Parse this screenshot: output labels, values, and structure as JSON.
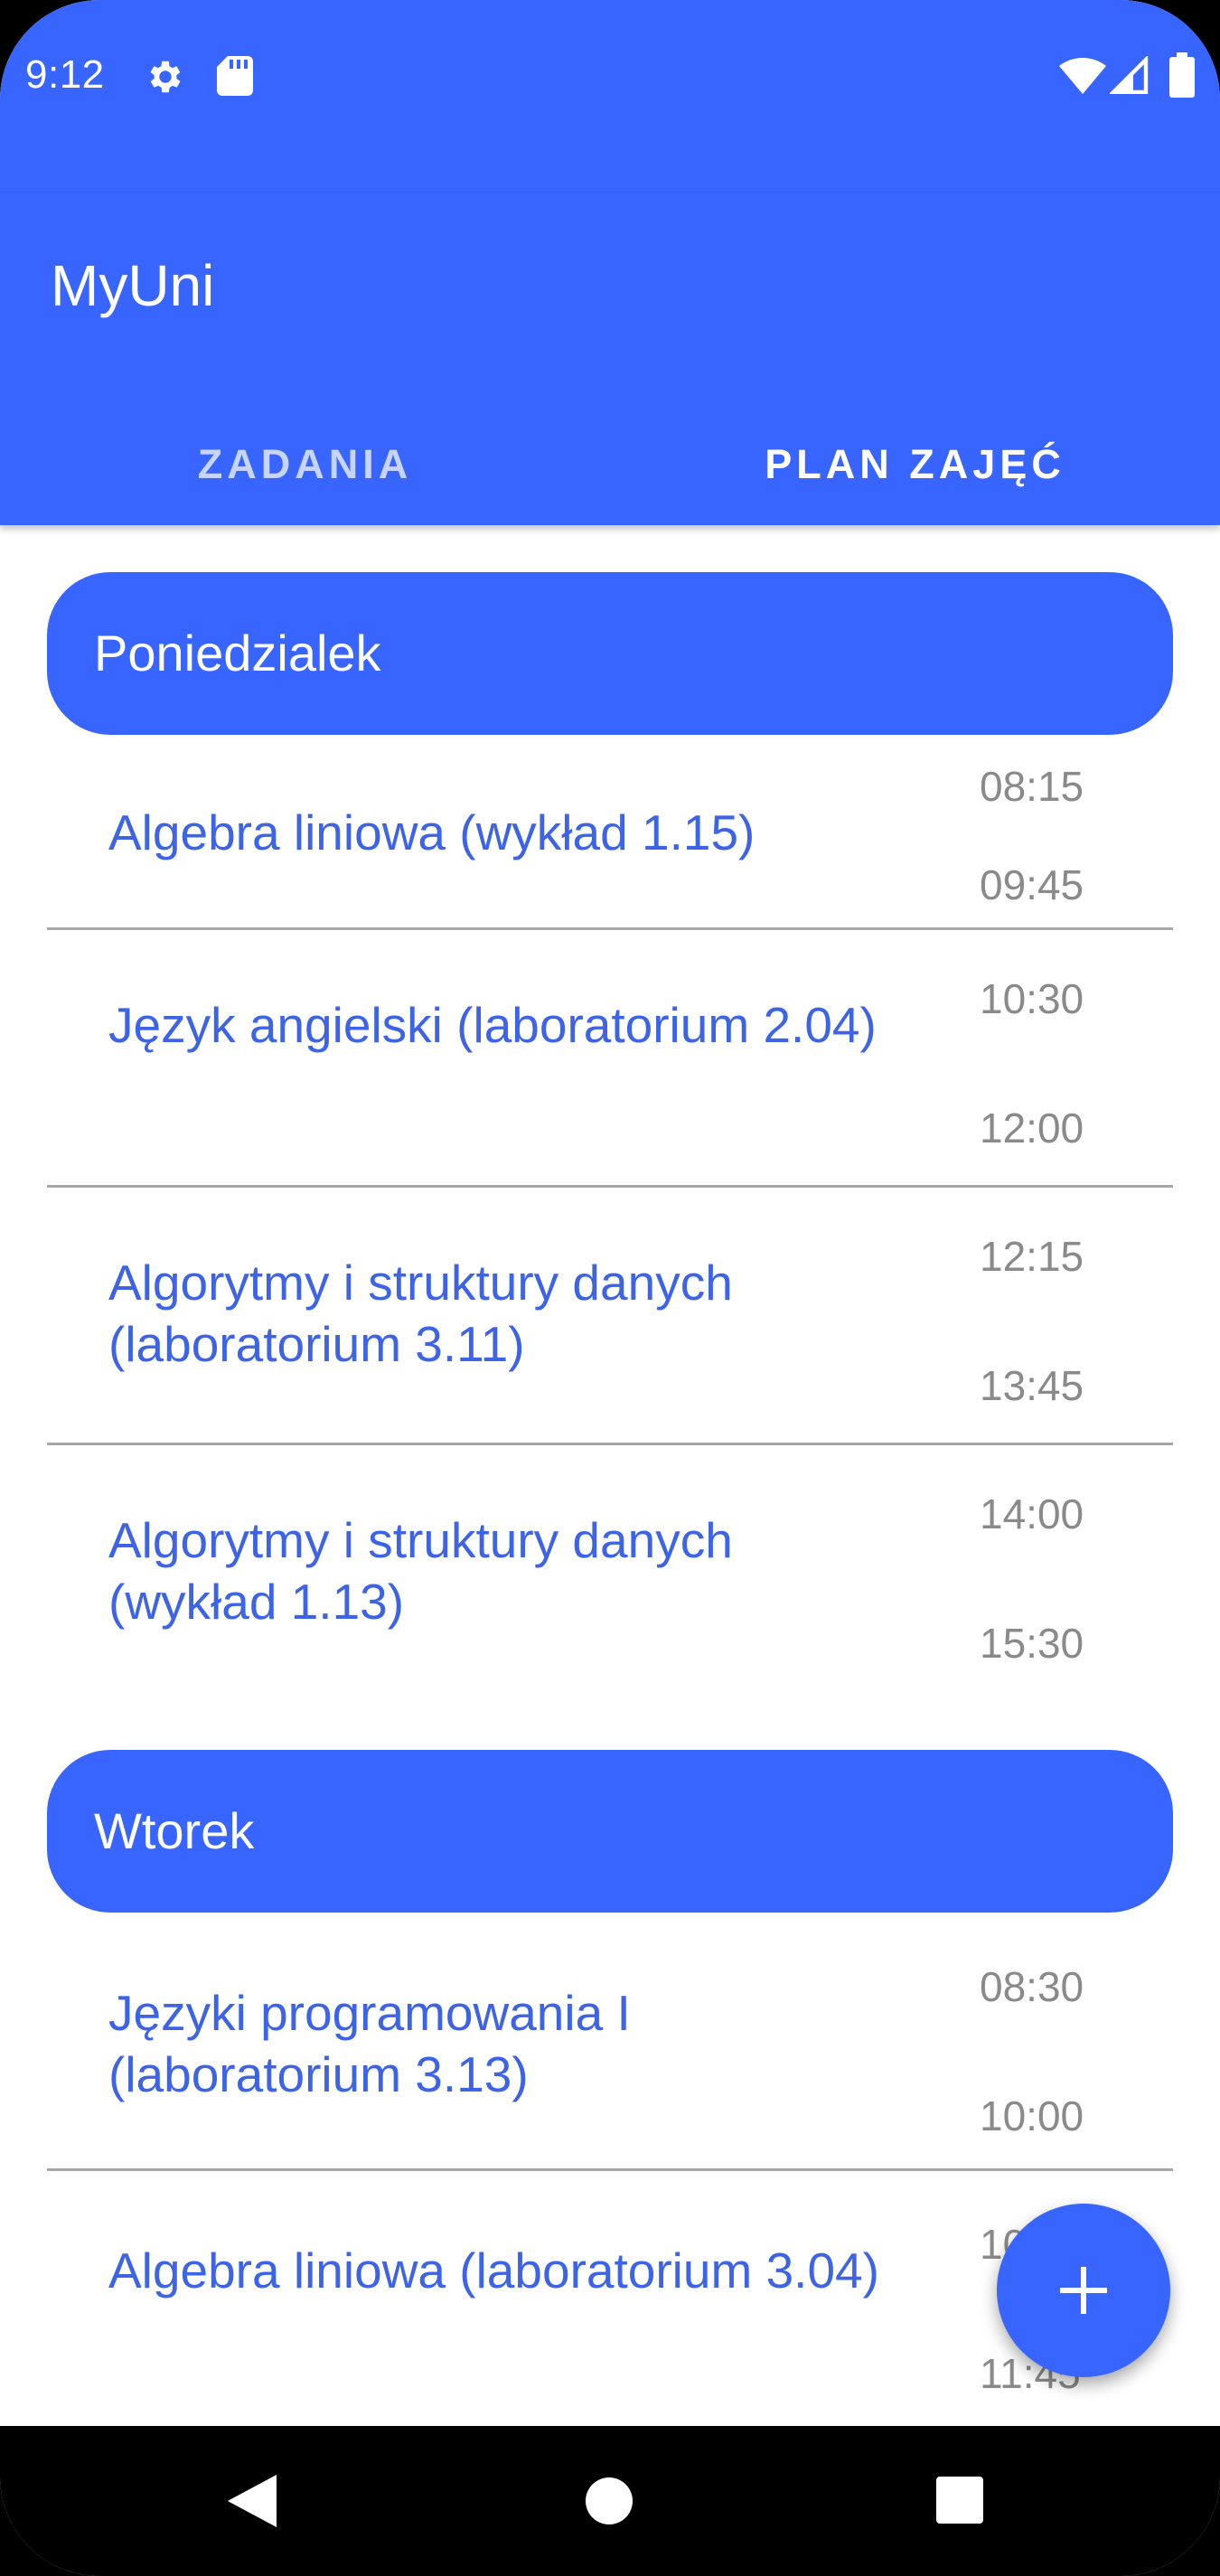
{
  "status_bar": {
    "time": "9:12",
    "left_icons": [
      "gear-icon",
      "sd-card-icon"
    ],
    "right_icons": [
      "wifi-icon",
      "signal-icon",
      "battery-icon"
    ]
  },
  "app_bar": {
    "title": "MyUni",
    "tabs": [
      {
        "label": "ZADANIA",
        "selected": false
      },
      {
        "label": "PLAN ZAJĘĆ",
        "selected": true
      }
    ]
  },
  "schedule": {
    "days": [
      {
        "name": "Poniedzialek",
        "classes": [
          {
            "name": "Algebra liniowa (wykład 1.15)",
            "start": "08:15",
            "end": "09:45"
          },
          {
            "name": "Język angielski (laboratorium 2.04)",
            "start": "10:30",
            "end": "12:00"
          },
          {
            "name": "Algorytmy i struktury danych (laboratorium 3.11)",
            "start": "12:15",
            "end": "13:45"
          },
          {
            "name": "Algorytmy i struktury danych (wykład 1.13)",
            "start": "14:00",
            "end": "15:30"
          }
        ]
      },
      {
        "name": "Wtorek",
        "classes": [
          {
            "name": "Języki programowania I (laboratorium 3.13)",
            "start": "08:30",
            "end": "10:00"
          },
          {
            "name": "Algebra liniowa (laboratorium 3.04)",
            "start": "10:15",
            "end": "11:45"
          }
        ]
      }
    ]
  },
  "fab": {
    "icon": "plus-icon"
  },
  "nav_bar": {
    "buttons": [
      "back-icon",
      "home-icon",
      "recents-icon"
    ]
  },
  "colors": {
    "primary": "#3864ff",
    "class_text": "#3d63e6",
    "time_text": "#8a8a8a",
    "divider": "#a8a8a8"
  }
}
